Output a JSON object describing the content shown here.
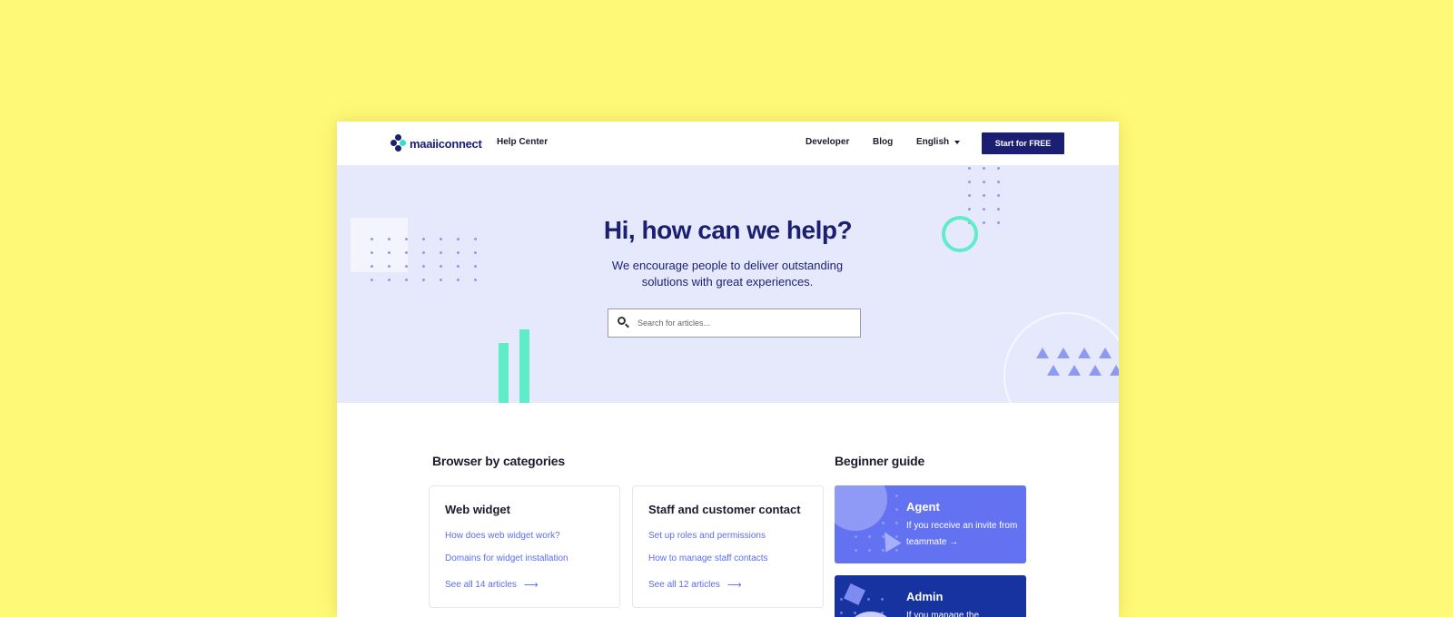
{
  "header": {
    "brand": "maaiiconnect",
    "help_center": "Help Center",
    "nav": {
      "developer": "Developer",
      "blog": "Blog",
      "language": "English"
    },
    "cta": "Start for FREE"
  },
  "hero": {
    "title": "Hi, how can we help?",
    "subtitle": "We encourage people to deliver outstanding solutions with great experiences.",
    "search_placeholder": "Search for articles..."
  },
  "categories": {
    "title": "Browser by categories",
    "cards": [
      {
        "title": "Web widget",
        "links": [
          "How does web widget work?",
          "Domains for widget installation"
        ],
        "see_all": "See all 14 articles"
      },
      {
        "title": "Staff and customer contact",
        "links": [
          "Set up roles and permissions",
          "How to manage staff contacts"
        ],
        "see_all": "See all 12 articles"
      }
    ]
  },
  "guide": {
    "title": "Beginner guide",
    "items": [
      {
        "title": "Agent",
        "text": "If you receive an invite from teammate →"
      },
      {
        "title": "Admin",
        "text": "If you manage the"
      }
    ]
  },
  "colors": {
    "page_bg": "#fff978",
    "brand_navy": "#1a1f71",
    "hero_bg": "#e6e9fc",
    "accent_mint": "#5eedc8",
    "link_blue": "#5b6cf0",
    "agent_card": "#6372f0",
    "admin_card": "#1633a0"
  },
  "icons": {
    "logo": "maaiiconnect-logo-icon",
    "search": "search-icon",
    "language_caret": "chevron-down-icon",
    "see_all_arrow": "arrow-right-icon"
  }
}
